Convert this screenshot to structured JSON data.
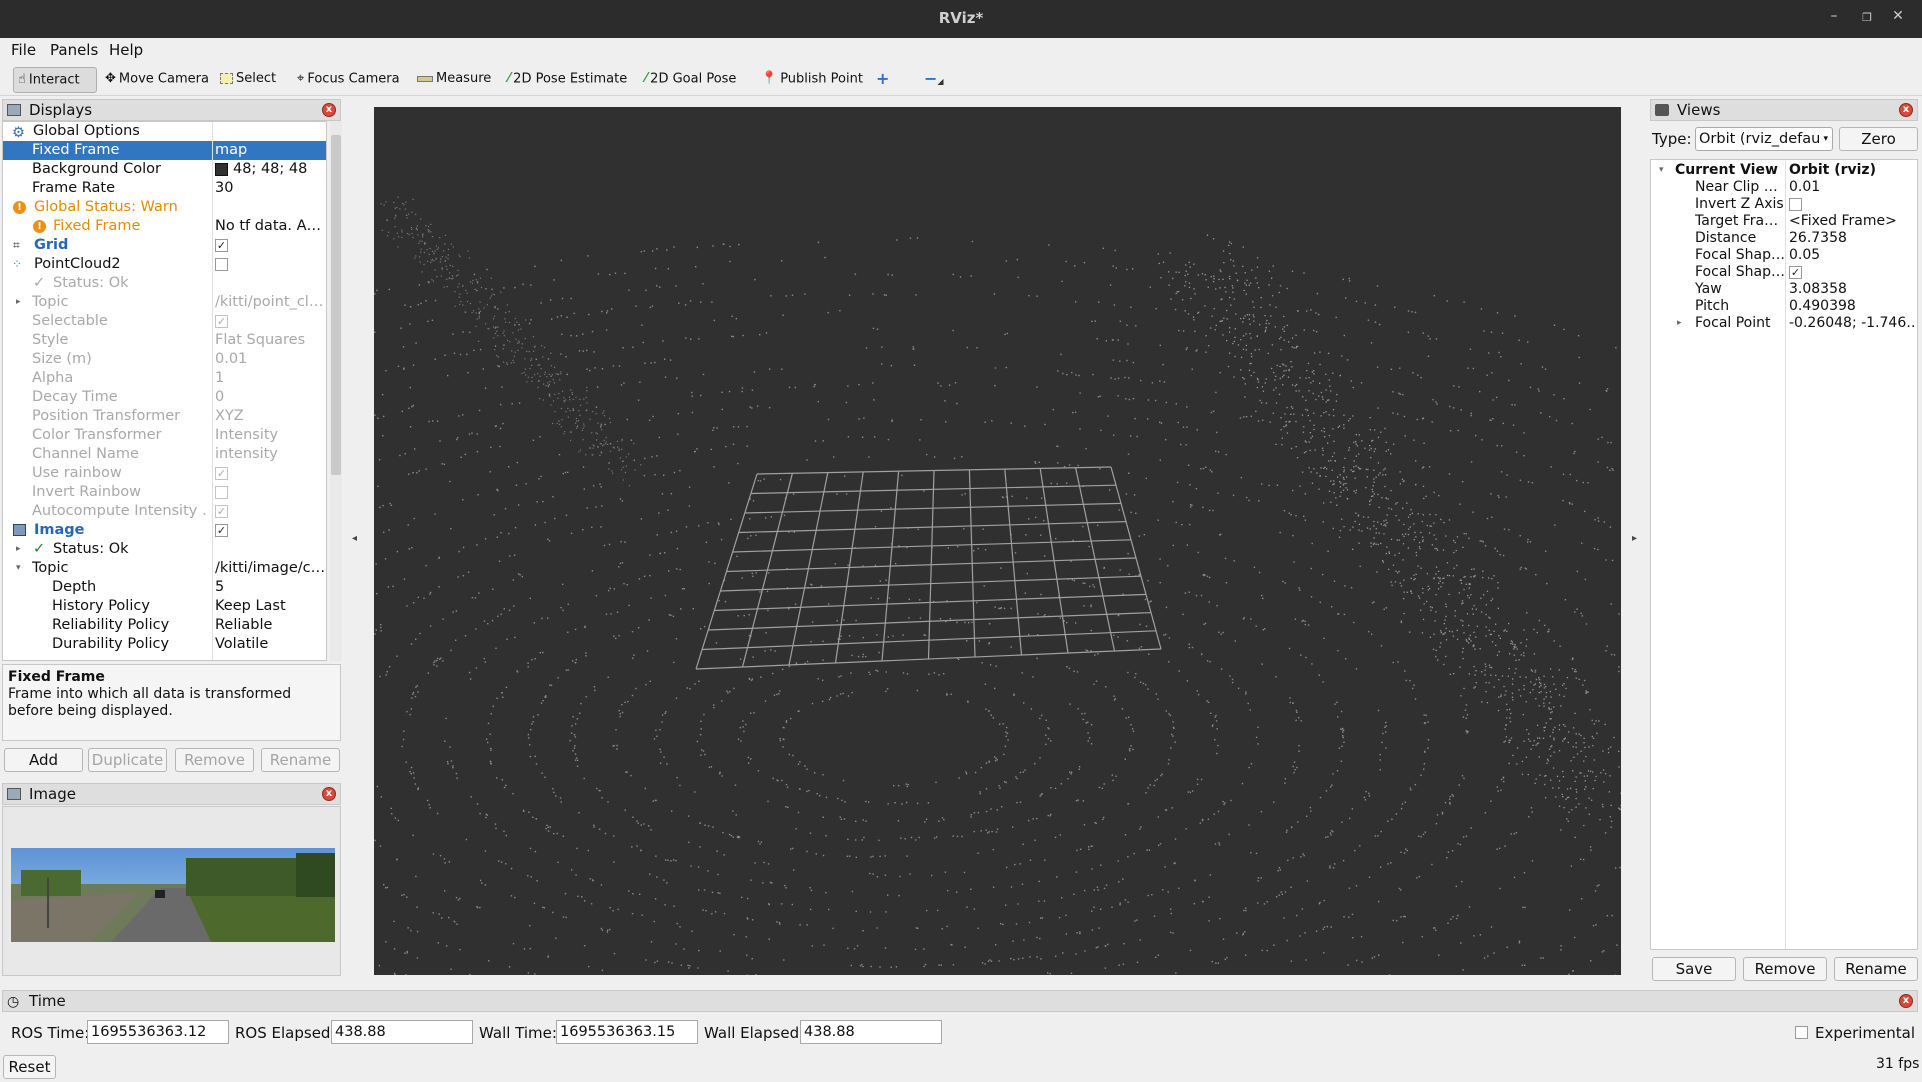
{
  "window": {
    "title": "RViz*"
  },
  "menu": [
    "File",
    "Panels",
    "Help"
  ],
  "toolbar": {
    "interact": "Interact",
    "move_camera": "Move Camera",
    "select": "Select",
    "focus_camera": "Focus Camera",
    "measure": "Measure",
    "pose_estimate": "2D Pose Estimate",
    "goal_pose": "2D Goal Pose",
    "publish_point": "Publish Point"
  },
  "displays": {
    "title": "Displays",
    "rows": [
      {
        "key": "Global Options",
        "val": ""
      },
      {
        "key": "Fixed Frame",
        "val": "map"
      },
      {
        "key": "Background Color",
        "val": "48; 48; 48"
      },
      {
        "key": "Frame Rate",
        "val": "30"
      },
      {
        "key": "Global Status: Warn",
        "val": ""
      },
      {
        "key": "Fixed Frame",
        "val": "No tf data.  A…"
      },
      {
        "key": "Grid",
        "val": ""
      },
      {
        "key": "PointCloud2",
        "val": ""
      },
      {
        "key": "Status: Ok",
        "val": ""
      },
      {
        "key": "Topic",
        "val": "/kitti/point_cl…"
      },
      {
        "key": "Selectable",
        "val": ""
      },
      {
        "key": "Style",
        "val": "Flat Squares"
      },
      {
        "key": "Size (m)",
        "val": "0.01"
      },
      {
        "key": "Alpha",
        "val": "1"
      },
      {
        "key": "Decay Time",
        "val": "0"
      },
      {
        "key": "Position Transformer",
        "val": "XYZ"
      },
      {
        "key": "Color Transformer",
        "val": "Intensity"
      },
      {
        "key": "Channel Name",
        "val": "intensity"
      },
      {
        "key": "Use rainbow",
        "val": ""
      },
      {
        "key": "Invert Rainbow",
        "val": ""
      },
      {
        "key": "Autocompute Intensity …",
        "val": ""
      },
      {
        "key": "Image",
        "val": ""
      },
      {
        "key": "Status: Ok",
        "val": ""
      },
      {
        "key": "Topic",
        "val": "/kitti/image/c…"
      },
      {
        "key": "Depth",
        "val": "5"
      },
      {
        "key": "History Policy",
        "val": "Keep Last"
      },
      {
        "key": "Reliability Policy",
        "val": "Reliable"
      },
      {
        "key": "Durability Policy",
        "val": "Volatile"
      }
    ],
    "desc_title": "Fixed Frame",
    "desc_text": "Frame into which all data is transformed before being displayed.",
    "buttons": {
      "add": "Add",
      "duplicate": "Duplicate",
      "remove": "Remove",
      "rename": "Rename"
    }
  },
  "image_panel": {
    "title": "Image"
  },
  "views": {
    "title": "Views",
    "type_label": "Type:",
    "type_value": "Orbit (rviz_defau",
    "zero": "Zero",
    "rows": [
      {
        "key": "Current View",
        "val": "Orbit (rviz)"
      },
      {
        "key": "Near Clip …",
        "val": "0.01"
      },
      {
        "key": "Invert Z Axis",
        "val": ""
      },
      {
        "key": "Target Fra…",
        "val": "<Fixed Frame>"
      },
      {
        "key": "Distance",
        "val": "26.7358"
      },
      {
        "key": "Focal Shap…",
        "val": "0.05"
      },
      {
        "key": "Focal Shap…",
        "val": ""
      },
      {
        "key": "Yaw",
        "val": "3.08358"
      },
      {
        "key": "Pitch",
        "val": "0.490398"
      },
      {
        "key": "Focal Point",
        "val": "-0.26048; -1.746…"
      }
    ],
    "buttons": {
      "save": "Save",
      "remove": "Remove",
      "rename": "Rename"
    }
  },
  "time": {
    "title": "Time",
    "ros_time_label": "ROS Time:",
    "ros_time": "1695536363.12",
    "ros_elapsed_label": "ROS Elapsed:",
    "ros_elapsed": "438.88",
    "wall_time_label": "Wall Time:",
    "wall_time": "1695536363.15",
    "wall_elapsed_label": "Wall Elapsed:",
    "wall_elapsed": "438.88",
    "experimental": "Experimental",
    "reset": "Reset",
    "fps": "31 fps"
  }
}
